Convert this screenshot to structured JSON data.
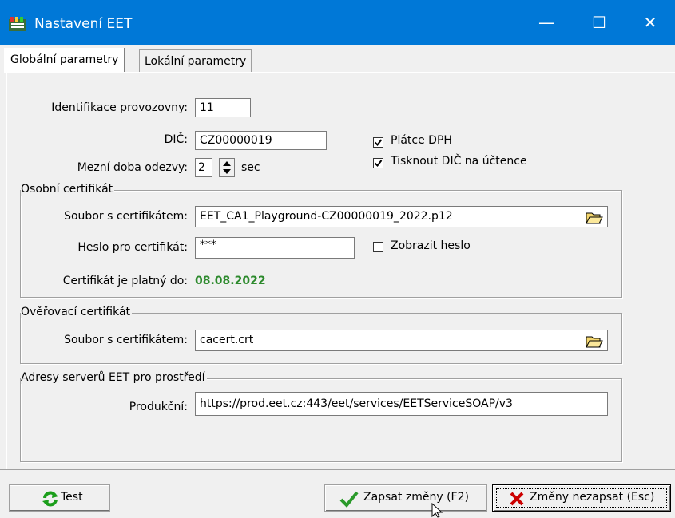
{
  "window": {
    "title": "Nastavení EET",
    "minimize_glyph": "—",
    "maximize_glyph": "☐",
    "close_glyph": "✕"
  },
  "tabs": [
    {
      "label": "Globální parametry",
      "active": true
    },
    {
      "label": "Lokální parametry",
      "active": false
    }
  ],
  "general": {
    "provozovna_label": "Identifikace provozovny:",
    "provozovna_value": "11",
    "dic_label": "DIČ:",
    "dic_value": "CZ00000019",
    "timeout_label": "Mezní doba odezvy:",
    "timeout_value": "2",
    "timeout_unit": "sec",
    "platce_dph_label": "Plátce DPH",
    "platce_dph_checked": true,
    "tisk_dic_label": "Tisknout DIČ na účtence",
    "tisk_dic_checked": true
  },
  "osobni_cert": {
    "title": "Osobní certifikát",
    "file_label": "Soubor s certifikátem:",
    "file_value": "EET_CA1_Playground-CZ00000019_2022.p12",
    "password_label": "Heslo pro certifikát:",
    "password_value": "***",
    "show_password_label": "Zobrazit heslo",
    "show_password_checked": false,
    "valid_label": "Certifikát je platný do:",
    "valid_value": "08.08.2022",
    "valid_color": "#2d8a2d"
  },
  "overovaci_cert": {
    "title": "Ověřovací certifikát",
    "file_label": "Soubor s certifikátem:",
    "file_value": "cacert.crt"
  },
  "servers": {
    "title": "Adresy serverů EET pro prostředí",
    "produkcni_label": "Produkční:",
    "produkcni_value": "https://prod.eet.cz:443/eet/services/EETServiceSOAP/v3"
  },
  "buttons": {
    "test_label": "Test",
    "save_label": "Zapsat změny (F2)",
    "cancel_label": "Změny nezapsat (Esc)"
  },
  "colors": {
    "titlebar": "#0078d7",
    "ok_green": "#2d8a2d",
    "cancel_red": "#cc0000"
  },
  "icons": {
    "app": "eet-app-icon",
    "browse": "folder-open-icon",
    "test": "refresh-icon",
    "save": "checkmark-icon",
    "cancel": "x-icon"
  }
}
